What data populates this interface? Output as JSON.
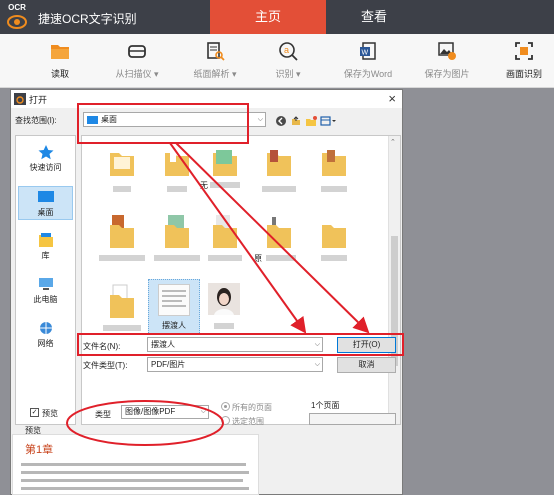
{
  "app": {
    "logo_text": "OCR",
    "title": "捷速OCR文字识别",
    "tabs": [
      "主页",
      "查看"
    ]
  },
  "toolbar": [
    {
      "label": "读取",
      "icon": "folder-icon"
    },
    {
      "label": "从扫描仪 ▾",
      "icon": "scanner-icon"
    },
    {
      "label": "纸面解析 ▾",
      "icon": "page-analyze-icon"
    },
    {
      "label": "识别 ▾",
      "icon": "recognize-icon"
    },
    {
      "label": "保存为Word",
      "icon": "word-icon"
    },
    {
      "label": "保存为图片",
      "icon": "save-image-icon"
    },
    {
      "label": "画面识别",
      "icon": "screen-capture-icon"
    }
  ],
  "dialog": {
    "title": "打开",
    "close": "×",
    "lookin_label": "查找范围(I):",
    "lookin_value": "桌面",
    "places": [
      "快速访问",
      "桌面",
      "库",
      "此电脑",
      "网络"
    ],
    "files": [
      "无",
      "原",
      "摆渡人"
    ],
    "filename_label": "文件名(N):",
    "filename_value": "摆渡人",
    "filetype_label": "文件类型(T):",
    "filetype_value": "PDF/图片",
    "open_button": "打开(O)",
    "cancel_button": "取消",
    "preview_check_label": "预览",
    "type_label": "类型",
    "type_value": "图像/图像PDF",
    "all_pages": "所有的页面",
    "selected_range": "选定范围",
    "page_count": "1个页面",
    "preview_label": "预览",
    "preview_chapter": "第1章"
  },
  "colors": {
    "topbar": "#3d4048",
    "active_tab": "#e34f37",
    "annotation": "#e0202a",
    "toolbar_icon": "#f08c1e"
  }
}
